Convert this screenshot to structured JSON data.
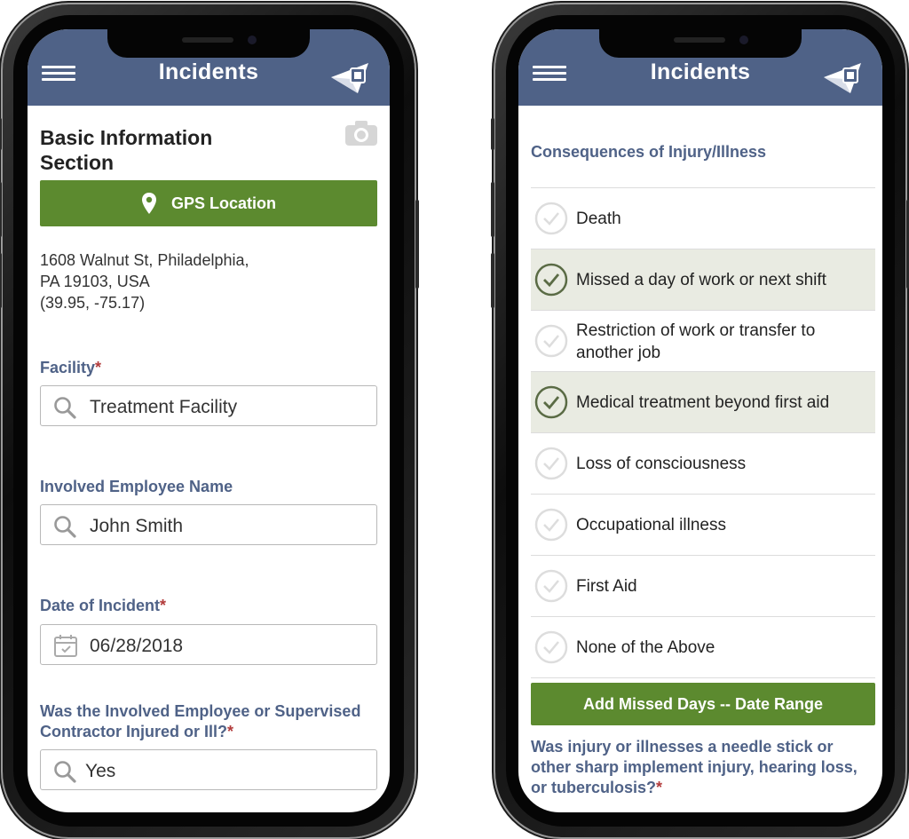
{
  "phone_left": {
    "header": {
      "title": "Incidents",
      "menu_icon": "hamburger-menu-icon",
      "logo_icon": "app-logo-icon"
    },
    "section_title": "Basic Information Section",
    "camera_icon": "camera-icon",
    "gps_button": {
      "label": "GPS Location",
      "icon": "map-pin-icon"
    },
    "address": {
      "line1": "1608 Walnut St, Philadelphia,",
      "line2": "PA 19103, USA",
      "line3": "(39.95, -75.17)"
    },
    "facility": {
      "label": "Facility",
      "required": "*",
      "value": "Treatment Facility",
      "icon": "search-icon"
    },
    "employee": {
      "label": "Involved Employee Name",
      "value": "John Smith",
      "icon": "search-icon"
    },
    "date": {
      "label": "Date of Incident",
      "required": "*",
      "value": "06/28/2018",
      "icon": "calendar-icon"
    },
    "injured": {
      "label_line1": "Was the Involved Employee or Supervised",
      "label_line2": "Contractor Injured or Ill?",
      "required": "*",
      "value": "Yes",
      "icon": "search-icon"
    }
  },
  "phone_right": {
    "header": {
      "title": "Incidents",
      "menu_icon": "hamburger-menu-icon",
      "logo_icon": "app-logo-icon"
    },
    "consequences_title": "Consequences of Injury/Illness",
    "options": [
      {
        "line1": "Death",
        "line2": "",
        "checked": false
      },
      {
        "line1": "Missed a day of work or next shift",
        "line2": "",
        "checked": true
      },
      {
        "line1": "Restriction of work or transfer to",
        "line2": "another job",
        "checked": false
      },
      {
        "line1": "Medical treatment beyond first aid",
        "line2": "",
        "checked": true
      },
      {
        "line1": "Loss of consciousness",
        "line2": "",
        "checked": false
      },
      {
        "line1": "Occupational illness",
        "line2": "",
        "checked": false
      },
      {
        "line1": "First Aid",
        "line2": "",
        "checked": false
      },
      {
        "line1": "None of the Above",
        "line2": "",
        "checked": false
      }
    ],
    "missed_days_button": {
      "label": "Add Missed Days -- Date Range"
    },
    "question": {
      "line1": "Was injury or illnesses a needle stick or",
      "line2": "other sharp implement injury, hearing loss,",
      "line3": "or tuberculosis?",
      "required": "*"
    }
  },
  "colors": {
    "header": "#4f6287",
    "accent_green": "#5c8a2f",
    "label_blue": "#4f6287",
    "required_red": "#b23b3b",
    "selected_row": "#e9ebe2"
  }
}
